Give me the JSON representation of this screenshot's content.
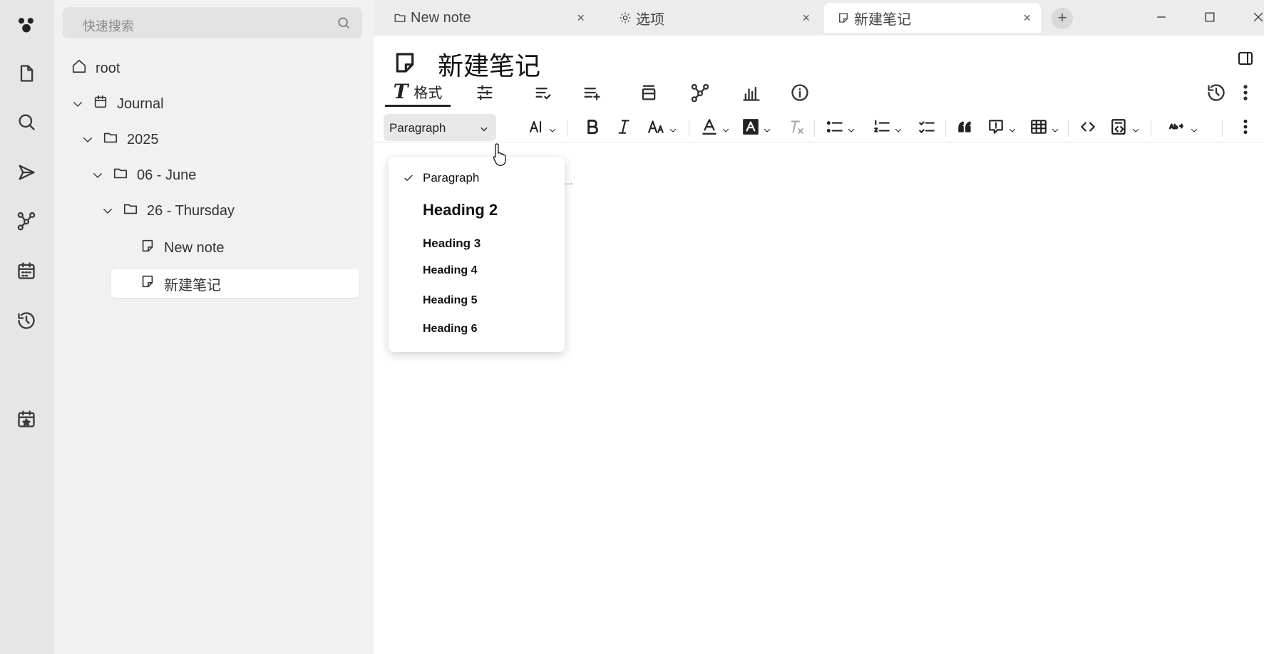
{
  "sidebar_icons": [
    "logo-icon",
    "file-icon",
    "search-icon",
    "send-icon",
    "graph-icon",
    "calendar-icon",
    "history-icon",
    "calendar-star-icon"
  ],
  "tree": {
    "search_placeholder": "快速搜索",
    "nodes": [
      {
        "label": "root",
        "icon": "home-icon",
        "level": 0
      },
      {
        "label": "Journal",
        "icon": "calendar-icon",
        "level": 1,
        "expanded": true
      },
      {
        "label": "2025",
        "icon": "folder-icon",
        "level": 2,
        "expanded": true
      },
      {
        "label": "06 - June",
        "icon": "folder-icon",
        "level": 3,
        "expanded": true
      },
      {
        "label": "26 - Thursday",
        "icon": "folder-icon",
        "level": 4,
        "expanded": true
      },
      {
        "label": "New note",
        "icon": "note-icon",
        "level": 5
      },
      {
        "label": "新建笔记",
        "icon": "note-icon",
        "level": 5,
        "selected": true
      }
    ]
  },
  "tabs": [
    {
      "label": "New note",
      "icon": "folder-icon",
      "close": "×"
    },
    {
      "label": "选项",
      "icon": "gear-icon",
      "close": "×"
    },
    {
      "label": "新建笔记",
      "icon": "note-icon",
      "close": "×",
      "active": true
    }
  ],
  "new_tab": "+",
  "note": {
    "title": "新建笔记"
  },
  "ribbon": {
    "format_label": "格式",
    "tabs": [
      "format",
      "settings",
      "checklist",
      "add-list",
      "collapse",
      "graph",
      "bar-chart",
      "info"
    ]
  },
  "toolbar": {
    "block_type": "Paragraph",
    "items": [
      "text-size",
      "bold",
      "italic",
      "font-case",
      "text-color",
      "highlight",
      "clear-format",
      "bullet-list",
      "numbered-list",
      "todo-list",
      "quote",
      "callout",
      "table",
      "code",
      "code-block",
      "spellcheck",
      "more"
    ]
  },
  "dropdown": {
    "options": [
      "Paragraph",
      "Heading 2",
      "Heading 3",
      "Heading 4",
      "Heading 5",
      "Heading 6"
    ],
    "selected": "Paragraph"
  },
  "editor_placeholder": "..."
}
